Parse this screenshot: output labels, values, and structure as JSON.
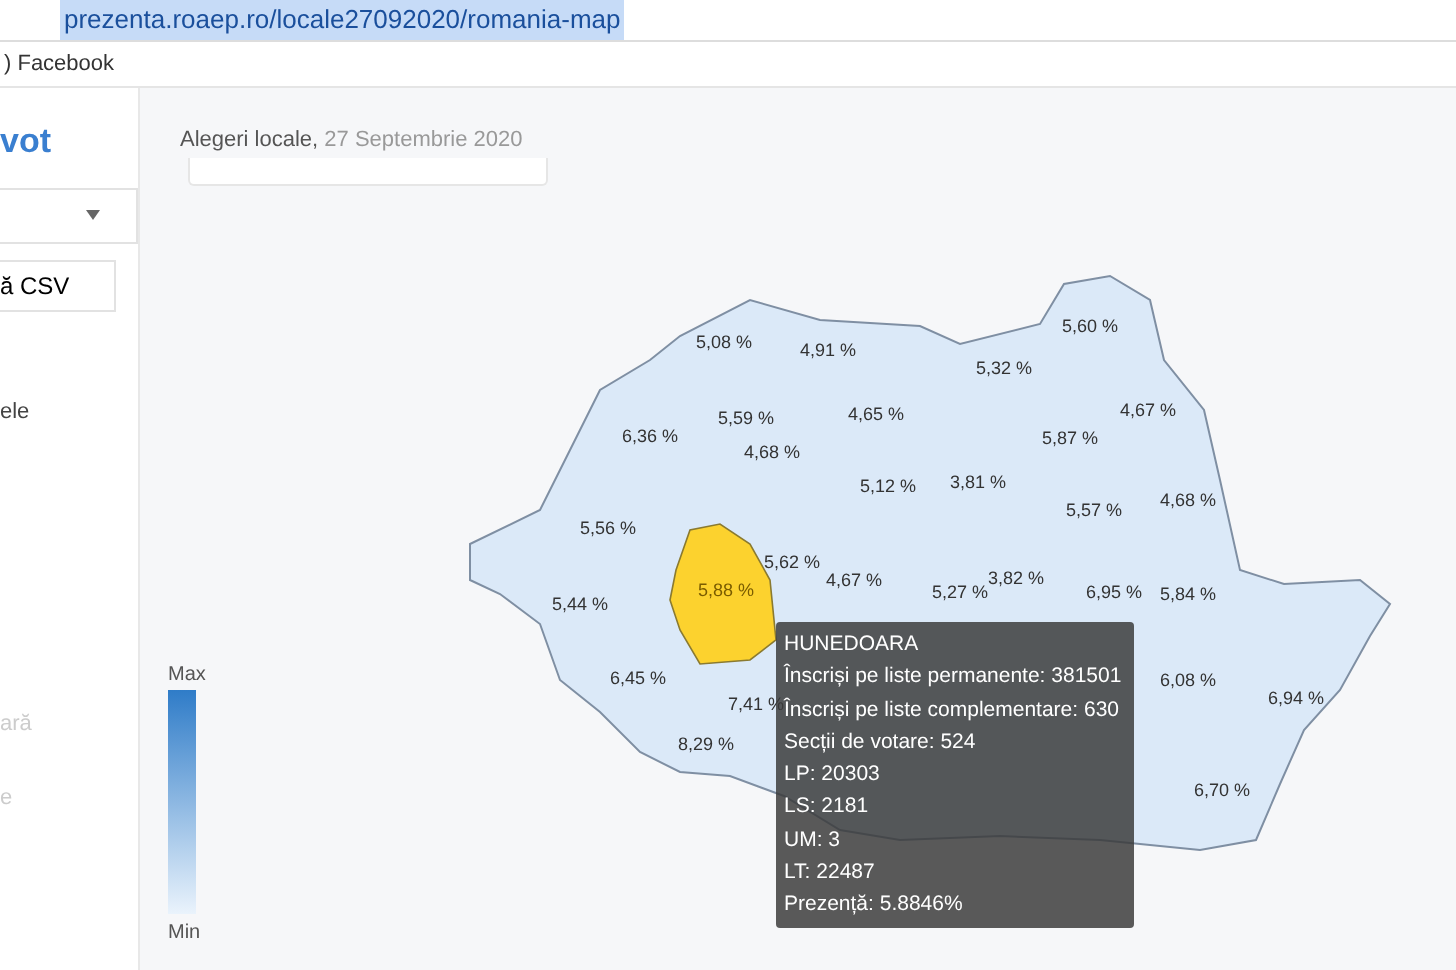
{
  "browser": {
    "url": "prezenta.roaep.ro/locale27092020/romania-map",
    "bookmarks": [
      ") Facebook"
    ]
  },
  "sidebar": {
    "title": "vot",
    "button": "ă CSV",
    "items": [
      {
        "label": "ele",
        "disabled": false
      },
      {
        "label": "ară",
        "disabled": true
      },
      {
        "label": "e",
        "disabled": true
      }
    ]
  },
  "header": {
    "title": "Alegeri locale,",
    "date": "27 Septembrie 2020"
  },
  "legend": {
    "max": "Max",
    "min": "Min"
  },
  "counties": [
    {
      "value": "5,08 %",
      "highlighted": false
    },
    {
      "value": "4,91 %",
      "highlighted": false
    },
    {
      "value": "5,32 %",
      "highlighted": false
    },
    {
      "value": "5,60 %",
      "highlighted": false
    },
    {
      "value": "4,67 %",
      "highlighted": false
    },
    {
      "value": "6,36 %",
      "highlighted": false
    },
    {
      "value": "5,59 %",
      "highlighted": false
    },
    {
      "value": "4,65 %",
      "highlighted": false
    },
    {
      "value": "4,68 %",
      "highlighted": false
    },
    {
      "value": "5,87 %",
      "highlighted": false
    },
    {
      "value": "5,12 %",
      "highlighted": false
    },
    {
      "value": "3,81 %",
      "highlighted": false
    },
    {
      "value": "5,57 %",
      "highlighted": false
    },
    {
      "value": "4,68 %",
      "highlighted": false
    },
    {
      "value": "5,56 %",
      "highlighted": false
    },
    {
      "value": "5,62 %",
      "highlighted": false
    },
    {
      "value": "5,88 %",
      "highlighted": true
    },
    {
      "value": "4,67 %",
      "highlighted": false
    },
    {
      "value": "5,27 %",
      "highlighted": false
    },
    {
      "value": "3,82 %",
      "highlighted": false
    },
    {
      "value": "6,95 %",
      "highlighted": false
    },
    {
      "value": "5,84 %",
      "highlighted": false
    },
    {
      "value": "5,44 %",
      "highlighted": false
    },
    {
      "value": "6,45 %",
      "highlighted": false
    },
    {
      "value": "7,41 %",
      "highlighted": false
    },
    {
      "value": "8,29 %",
      "highlighted": false
    },
    {
      "value": "6,08 %",
      "highlighted": false
    },
    {
      "value": "6,94 %",
      "highlighted": false
    },
    {
      "value": "6,70 %",
      "highlighted": false
    }
  ],
  "tooltip": {
    "title": "HUNEDOARA",
    "lines": [
      "Înscriși pe liste permanente: 381501",
      "Înscriși pe liste complementare: 630",
      "Secții de votare: 524",
      "LP: 20303",
      "LS: 2181",
      "UM: 3",
      "LT: 22487",
      "Prezență: 5.8846%"
    ]
  }
}
